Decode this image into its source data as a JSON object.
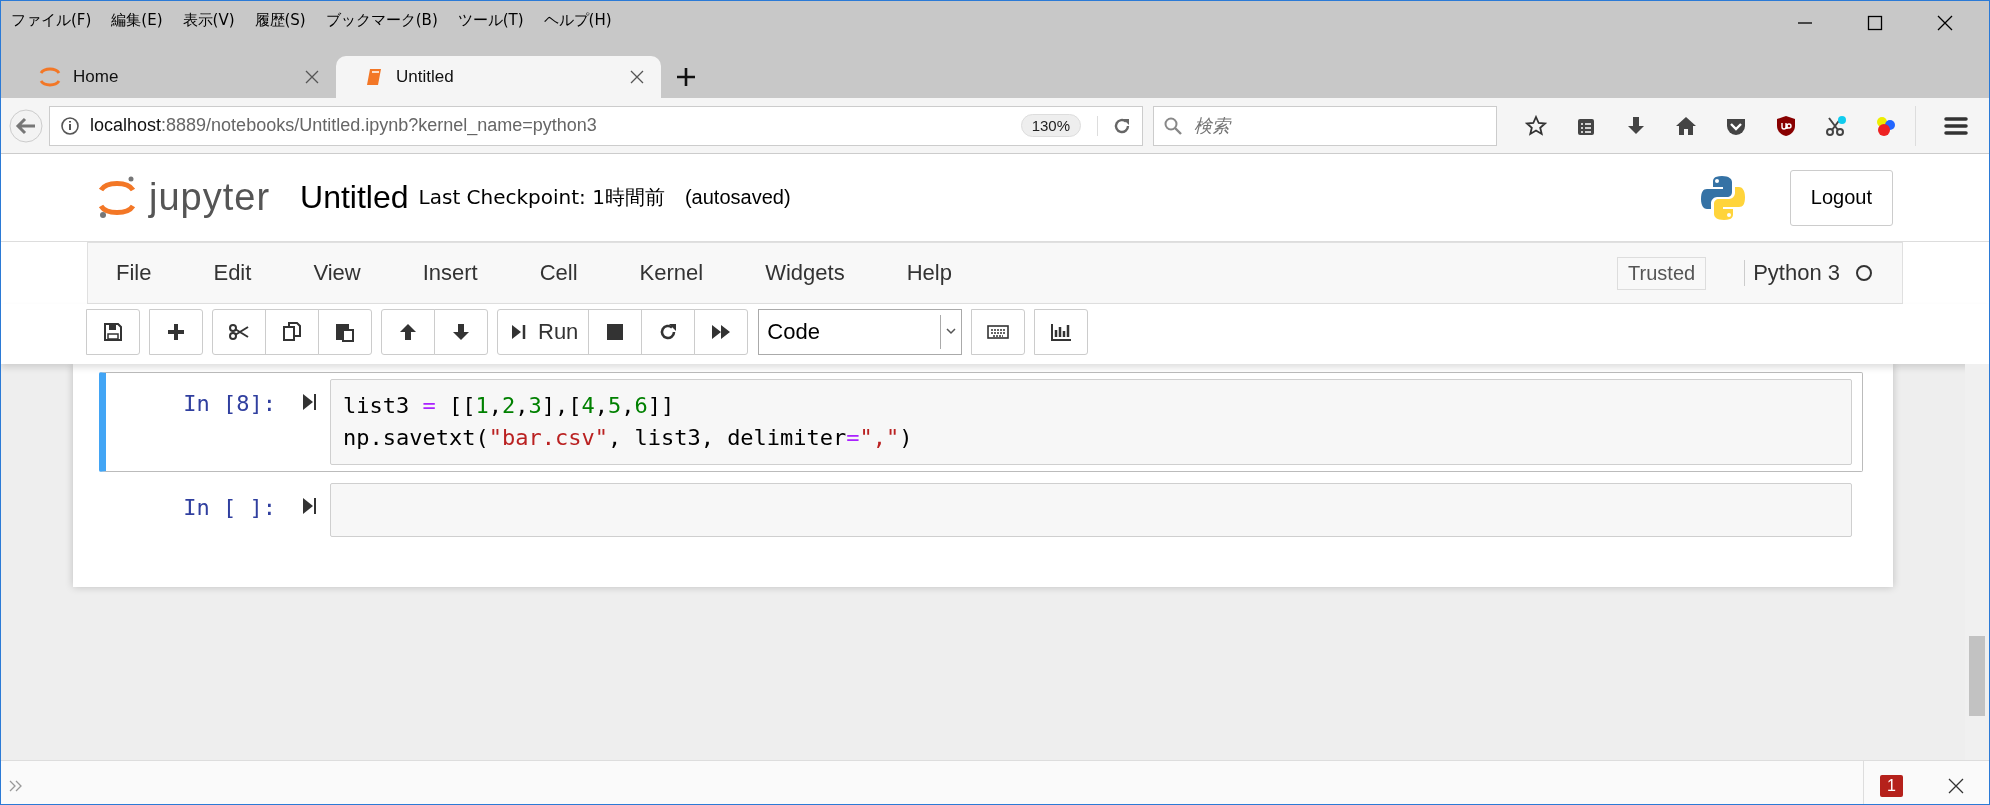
{
  "browser": {
    "menu": [
      "ファイル(F)",
      "編集(E)",
      "表示(V)",
      "履歴(S)",
      "ブックマーク(B)",
      "ツール(T)",
      "ヘルプ(H)"
    ],
    "tabs": [
      {
        "label": "Home",
        "selected": false
      },
      {
        "label": "Untitled",
        "selected": true
      }
    ],
    "url": {
      "host": "localhost",
      "rest": ":8889/notebooks/Untitled.ipynb?kernel_name=python3"
    },
    "zoom": "130%",
    "search": {
      "placeholder": "検索"
    }
  },
  "notebook": {
    "logo": "jupyter",
    "title": "Untitled",
    "checkpoint": "Last Checkpoint: 1時間前",
    "autosave": "(autosaved)",
    "logout": "Logout",
    "menu": [
      "File",
      "Edit",
      "View",
      "Insert",
      "Cell",
      "Kernel",
      "Widgets",
      "Help"
    ],
    "trusted": "Trusted",
    "kernel": "Python 3",
    "kernel_busy": false,
    "run_label": "Run",
    "cell_type": "Code",
    "cells": [
      {
        "prompt": "In [8]:",
        "selected": true,
        "lines": [
          [
            {
              "kind": "plain",
              "text": "list3 "
            },
            {
              "kind": "op",
              "text": "="
            },
            {
              "kind": "plain",
              "text": " [["
            },
            {
              "kind": "num",
              "text": "1"
            },
            {
              "kind": "plain",
              "text": ","
            },
            {
              "kind": "num",
              "text": "2"
            },
            {
              "kind": "plain",
              "text": ","
            },
            {
              "kind": "num",
              "text": "3"
            },
            {
              "kind": "plain",
              "text": "],["
            },
            {
              "kind": "num",
              "text": "4"
            },
            {
              "kind": "plain",
              "text": ","
            },
            {
              "kind": "num",
              "text": "5"
            },
            {
              "kind": "plain",
              "text": ","
            },
            {
              "kind": "num",
              "text": "6"
            },
            {
              "kind": "plain",
              "text": "]]"
            }
          ],
          [
            {
              "kind": "plain",
              "text": "np.savetxt("
            },
            {
              "kind": "str",
              "text": "\"bar.csv\""
            },
            {
              "kind": "plain",
              "text": ", list3, delimiter"
            },
            {
              "kind": "op",
              "text": "="
            },
            {
              "kind": "str",
              "text": "\",\""
            },
            {
              "kind": "plain",
              "text": ")"
            }
          ]
        ]
      },
      {
        "prompt": "In [ ]:",
        "selected": false
      }
    ]
  },
  "findbar": {
    "badge": "1"
  }
}
